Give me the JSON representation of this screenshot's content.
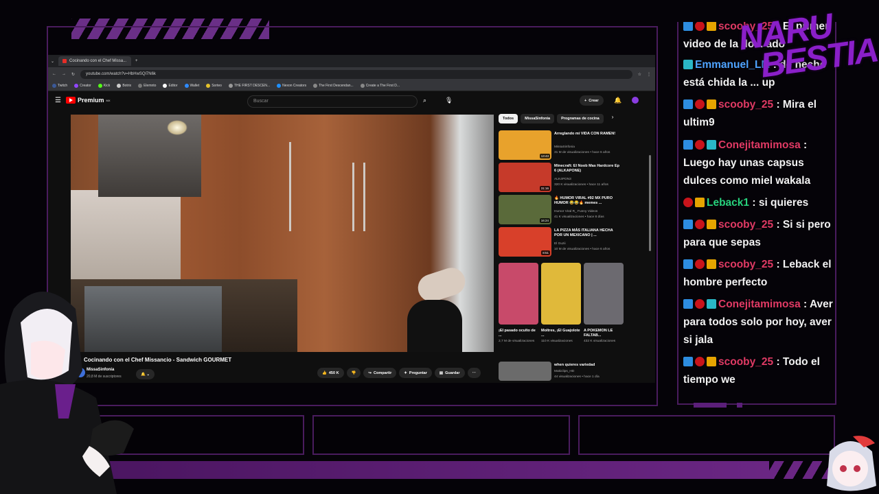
{
  "browser": {
    "tab_title": "Cocinando con el Chef Missa...",
    "url": "youtube.com/watch?v=HbHwSQl7N6k",
    "bookmarks": [
      "F",
      "Twitch",
      "Creator",
      "Kick",
      "Botrix",
      "Elemnto",
      "Editor",
      "Wallet",
      "Sorteo",
      "THE FIRST DESCEN...",
      "Nexon Creators",
      "The First Descendan...",
      "Create a The First D..."
    ]
  },
  "youtube": {
    "logo": "Premium",
    "logo_sup": "MX",
    "search_placeholder": "Buscar",
    "create_label": "Crear",
    "video_title": "Cocinando con el Chef Missancio - Sandwich GOURMET",
    "channel": "MissaSinfonia",
    "subscribers": "20,8 M de suscriptores",
    "likes": "450 K",
    "share": "Compartir",
    "ask": "Preguntar",
    "save": "Guardar",
    "chips": [
      "Todos",
      "MissaSinfonia",
      "Programas de cocina"
    ],
    "recommendations": [
      {
        "title": "Arreglando mi VIDA CON RAMEN!",
        "channel": "MissaSinfonia",
        "meta": "31 M de visualizaciones • hace 6 años",
        "duration": "13:43",
        "color": "#e8a22c"
      },
      {
        "title": "Minecraft: El Noob Mas Hardcore Ep 6 (ALKAPONE)",
        "channel": "ALK4PON3",
        "meta": "320 K visualizaciones • hace 11 años",
        "duration": "31:16",
        "color": "#c63a2a"
      },
      {
        "title": "🔥 HUMOR VIRAL #92 MX PURO HUMOR 😂😂🔥 memes ...",
        "channel": "Humor Viral R_ Funny Videos",
        "meta": "41 K visualizaciones • hace 8 días",
        "duration": "16:24",
        "color": "#5a6a3a"
      },
      {
        "title": "LA PIZZA MÁS ITALIANA HECHA POR UN MEXICANO | ...",
        "channel": "El Guzii",
        "meta": "10 M de visualizaciones • hace 6 años",
        "duration": "8:51",
        "color": "#d8402a"
      }
    ],
    "shorts": [
      {
        "title": "¡El pasado oculto de ...",
        "meta": "2,7 M de visualizaciones",
        "color": "#c84a6a"
      },
      {
        "title": "Moltres, ¡El Guajolote ...",
        "meta": "110 K visualizaciones",
        "color": "#e0b93a"
      },
      {
        "title": "A POKEMON LE FALTAB...",
        "meta": "432 K visualizaciones",
        "color": "#6c6a70"
      }
    ],
    "last_rec": {
      "title": "when quieres variedad",
      "channel": "Makiclips_HD",
      "meta": "44 visualizaciones • hace 1 día"
    }
  },
  "chat": [
    {
      "user": "scooby_25",
      "text": ": El primer video de la do... ado",
      "user_color": "pink",
      "badges": [
        "blue",
        "red",
        "gold"
      ]
    },
    {
      "user": "Emmanuel_LM",
      "text": ": de hecho está chida la ... up",
      "user_color": "blue",
      "badges": [
        "teal"
      ]
    },
    {
      "user": "scooby_25",
      "text": ": Mira el ultim9",
      "user_color": "pink",
      "badges": [
        "blue",
        "red",
        "gold"
      ]
    },
    {
      "user": "Conejitamimosa",
      "text": ": Luego hay unas capsus dulces como miel wakala",
      "user_color": "pink",
      "badges": [
        "blue",
        "red",
        "teal"
      ]
    },
    {
      "user": "Leback1",
      "text": ": si quieres",
      "user_color": "green",
      "badges": [
        "red",
        "gold"
      ]
    },
    {
      "user": "scooby_25",
      "text": ": Si si pero para que sepas",
      "user_color": "pink",
      "badges": [
        "blue",
        "red",
        "gold"
      ]
    },
    {
      "user": "scooby_25",
      "text": ": Leback el hombre perfecto",
      "user_color": "pink",
      "badges": [
        "blue",
        "red",
        "gold"
      ]
    },
    {
      "user": "Conejitamimosa",
      "text": ": Aver para todos solo por hoy, aver si jala",
      "user_color": "pink",
      "badges": [
        "blue",
        "red",
        "teal"
      ]
    },
    {
      "user": "scooby_25",
      "text": ": Todo el tiempo we",
      "user_color": "pink",
      "badges": [
        "blue",
        "red",
        "gold"
      ]
    }
  ],
  "brand": {
    "line1": "NARU",
    "line2": "BESTIA"
  }
}
